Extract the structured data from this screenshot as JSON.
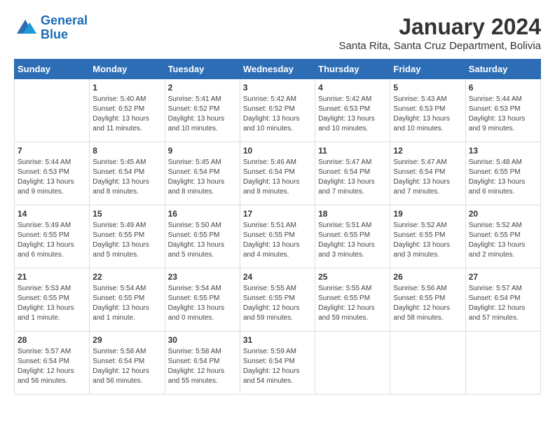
{
  "header": {
    "logo_line1": "General",
    "logo_line2": "Blue",
    "month_title": "January 2024",
    "subtitle": "Santa Rita, Santa Cruz Department, Bolivia"
  },
  "days_of_week": [
    "Sunday",
    "Monday",
    "Tuesday",
    "Wednesday",
    "Thursday",
    "Friday",
    "Saturday"
  ],
  "weeks": [
    [
      {
        "day": "",
        "info": ""
      },
      {
        "day": "1",
        "info": "Sunrise: 5:40 AM\nSunset: 6:52 PM\nDaylight: 13 hours\nand 11 minutes."
      },
      {
        "day": "2",
        "info": "Sunrise: 5:41 AM\nSunset: 6:52 PM\nDaylight: 13 hours\nand 10 minutes."
      },
      {
        "day": "3",
        "info": "Sunrise: 5:42 AM\nSunset: 6:52 PM\nDaylight: 13 hours\nand 10 minutes."
      },
      {
        "day": "4",
        "info": "Sunrise: 5:42 AM\nSunset: 6:53 PM\nDaylight: 13 hours\nand 10 minutes."
      },
      {
        "day": "5",
        "info": "Sunrise: 5:43 AM\nSunset: 6:53 PM\nDaylight: 13 hours\nand 10 minutes."
      },
      {
        "day": "6",
        "info": "Sunrise: 5:44 AM\nSunset: 6:53 PM\nDaylight: 13 hours\nand 9 minutes."
      }
    ],
    [
      {
        "day": "7",
        "info": "Sunrise: 5:44 AM\nSunset: 6:53 PM\nDaylight: 13 hours\nand 9 minutes."
      },
      {
        "day": "8",
        "info": "Sunrise: 5:45 AM\nSunset: 6:54 PM\nDaylight: 13 hours\nand 8 minutes."
      },
      {
        "day": "9",
        "info": "Sunrise: 5:45 AM\nSunset: 6:54 PM\nDaylight: 13 hours\nand 8 minutes."
      },
      {
        "day": "10",
        "info": "Sunrise: 5:46 AM\nSunset: 6:54 PM\nDaylight: 13 hours\nand 8 minutes."
      },
      {
        "day": "11",
        "info": "Sunrise: 5:47 AM\nSunset: 6:54 PM\nDaylight: 13 hours\nand 7 minutes."
      },
      {
        "day": "12",
        "info": "Sunrise: 5:47 AM\nSunset: 6:54 PM\nDaylight: 13 hours\nand 7 minutes."
      },
      {
        "day": "13",
        "info": "Sunrise: 5:48 AM\nSunset: 6:55 PM\nDaylight: 13 hours\nand 6 minutes."
      }
    ],
    [
      {
        "day": "14",
        "info": "Sunrise: 5:49 AM\nSunset: 6:55 PM\nDaylight: 13 hours\nand 6 minutes."
      },
      {
        "day": "15",
        "info": "Sunrise: 5:49 AM\nSunset: 6:55 PM\nDaylight: 13 hours\nand 5 minutes."
      },
      {
        "day": "16",
        "info": "Sunrise: 5:50 AM\nSunset: 6:55 PM\nDaylight: 13 hours\nand 5 minutes."
      },
      {
        "day": "17",
        "info": "Sunrise: 5:51 AM\nSunset: 6:55 PM\nDaylight: 13 hours\nand 4 minutes."
      },
      {
        "day": "18",
        "info": "Sunrise: 5:51 AM\nSunset: 6:55 PM\nDaylight: 13 hours\nand 3 minutes."
      },
      {
        "day": "19",
        "info": "Sunrise: 5:52 AM\nSunset: 6:55 PM\nDaylight: 13 hours\nand 3 minutes."
      },
      {
        "day": "20",
        "info": "Sunrise: 5:52 AM\nSunset: 6:55 PM\nDaylight: 13 hours\nand 2 minutes."
      }
    ],
    [
      {
        "day": "21",
        "info": "Sunrise: 5:53 AM\nSunset: 6:55 PM\nDaylight: 13 hours\nand 1 minute."
      },
      {
        "day": "22",
        "info": "Sunrise: 5:54 AM\nSunset: 6:55 PM\nDaylight: 13 hours\nand 1 minute."
      },
      {
        "day": "23",
        "info": "Sunrise: 5:54 AM\nSunset: 6:55 PM\nDaylight: 13 hours\nand 0 minutes."
      },
      {
        "day": "24",
        "info": "Sunrise: 5:55 AM\nSunset: 6:55 PM\nDaylight: 12 hours\nand 59 minutes."
      },
      {
        "day": "25",
        "info": "Sunrise: 5:55 AM\nSunset: 6:55 PM\nDaylight: 12 hours\nand 59 minutes."
      },
      {
        "day": "26",
        "info": "Sunrise: 5:56 AM\nSunset: 6:55 PM\nDaylight: 12 hours\nand 58 minutes."
      },
      {
        "day": "27",
        "info": "Sunrise: 5:57 AM\nSunset: 6:54 PM\nDaylight: 12 hours\nand 57 minutes."
      }
    ],
    [
      {
        "day": "28",
        "info": "Sunrise: 5:57 AM\nSunset: 6:54 PM\nDaylight: 12 hours\nand 56 minutes."
      },
      {
        "day": "29",
        "info": "Sunrise: 5:58 AM\nSunset: 6:54 PM\nDaylight: 12 hours\nand 56 minutes."
      },
      {
        "day": "30",
        "info": "Sunrise: 5:58 AM\nSunset: 6:54 PM\nDaylight: 12 hours\nand 55 minutes."
      },
      {
        "day": "31",
        "info": "Sunrise: 5:59 AM\nSunset: 6:54 PM\nDaylight: 12 hours\nand 54 minutes."
      },
      {
        "day": "",
        "info": ""
      },
      {
        "day": "",
        "info": ""
      },
      {
        "day": "",
        "info": ""
      }
    ]
  ]
}
